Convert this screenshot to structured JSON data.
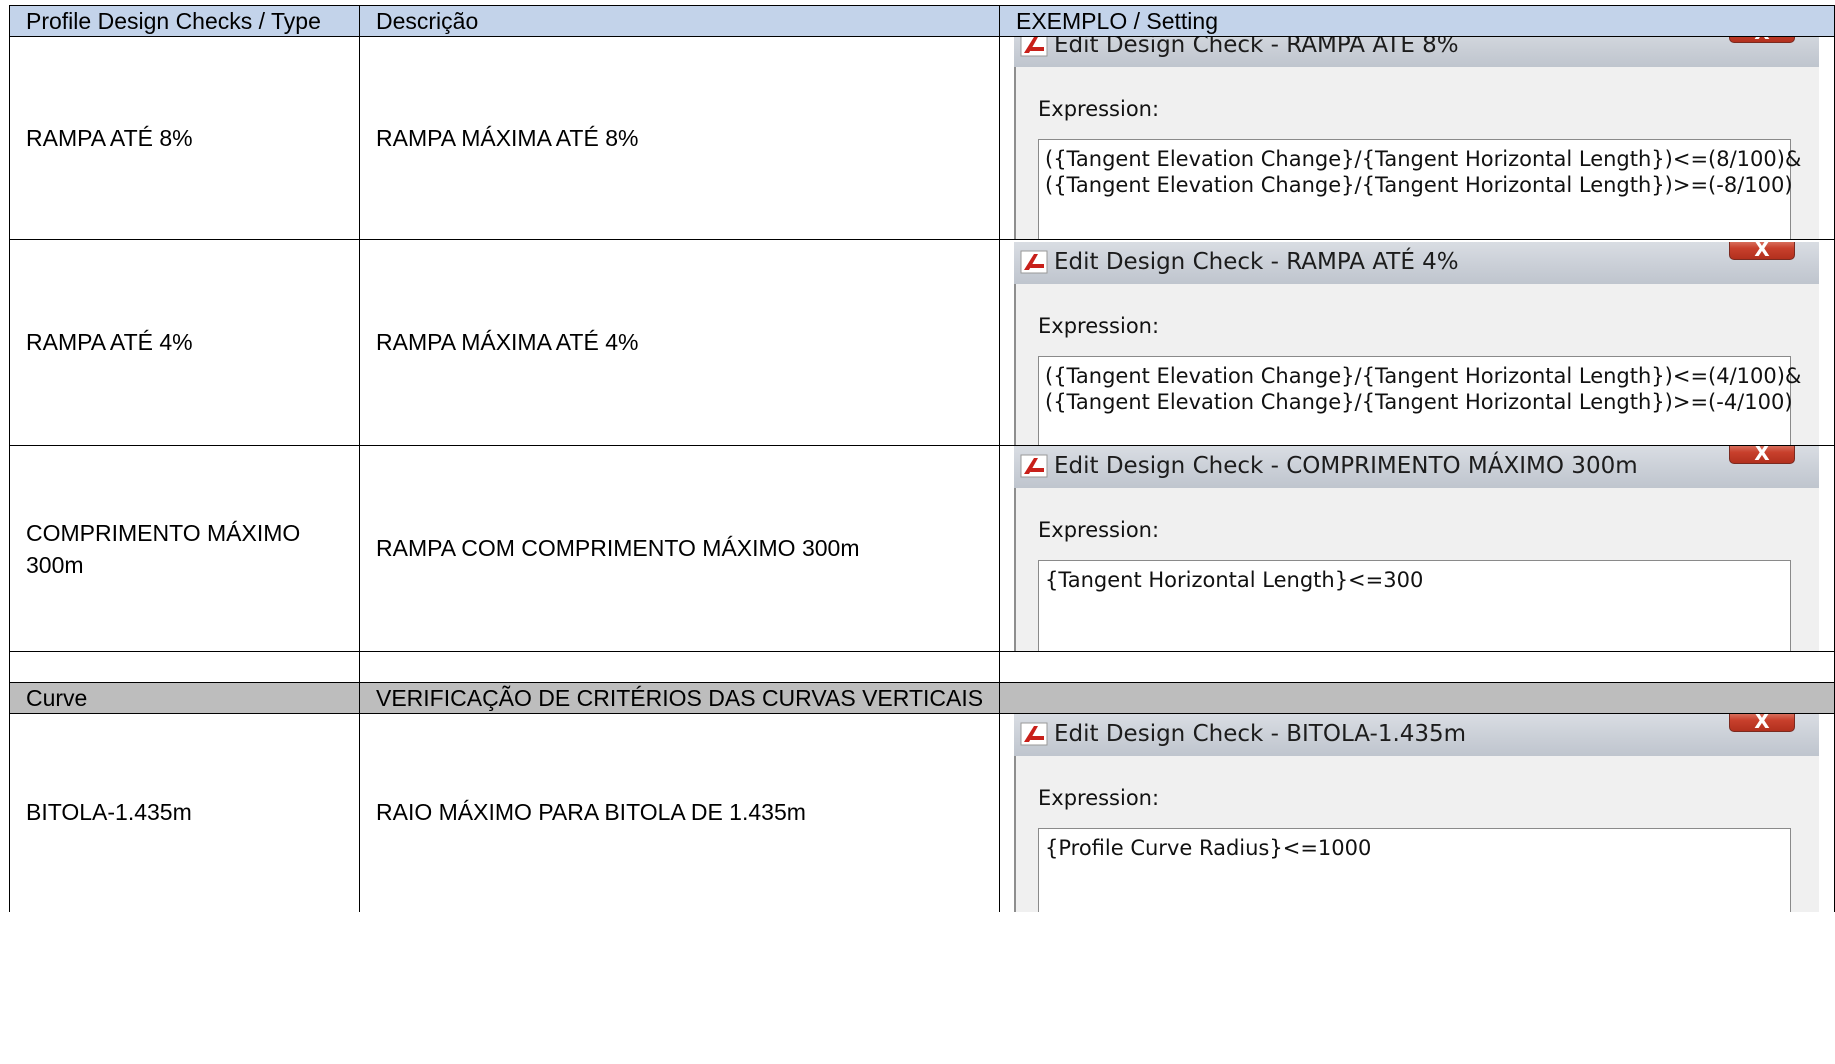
{
  "table": {
    "headers": [
      "Profile Design Checks / Type",
      "Descrição",
      "EXEMPLO / Setting"
    ],
    "rows": [
      {
        "type": "RAMPA ATÉ 8%",
        "description": "RAMPA MÁXIMA ATÉ 8%",
        "dialog": {
          "title": "Edit Design Check - RAMPA ATÉ 8%",
          "label": "Expression:",
          "expression": "({Tangent Elevation Change}/{Tangent Horizontal Length})<=(8/100)&\n({Tangent Elevation Change}/{Tangent Horizontal Length})>=(-8/100)"
        }
      },
      {
        "type": "RAMPA ATÉ 4%",
        "description": "RAMPA MÁXIMA ATÉ 4%",
        "dialog": {
          "title": "Edit Design Check - RAMPA ATÉ 4%",
          "label": "Expression:",
          "expression": "({Tangent Elevation Change}/{Tangent Horizontal Length})<=(4/100)&\n({Tangent Elevation Change}/{Tangent Horizontal Length})>=(-4/100)"
        }
      },
      {
        "type": "COMPRIMENTO MÁXIMO 300m",
        "description": "RAMPA COM COMPRIMENTO MÁXIMO 300m",
        "dialog": {
          "title": "Edit Design Check - COMPRIMENTO MÁXIMO 300m",
          "label": "Expression:",
          "expression": "{Tangent Horizontal Length}<=300"
        }
      }
    ],
    "section": {
      "type": "Curve",
      "description": "VERIFICAÇÃO DE CRITÉRIOS DAS CURVAS VERTICAIS"
    },
    "curve_rows": [
      {
        "type": "BITOLA-1.435m",
        "description": "RAIO MÁXIMO PARA BITOLA DE 1.435m",
        "dialog": {
          "title": "Edit Design Check - BITOLA-1.435m",
          "label": "Expression:",
          "expression": "{Profile Curve Radius}<=1000"
        }
      }
    ]
  },
  "dialog_icon": "civil3d-app-icon",
  "close_glyph": "X"
}
